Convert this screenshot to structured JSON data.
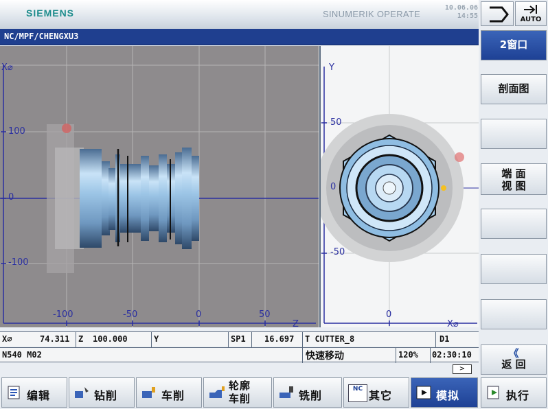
{
  "header": {
    "brand": "SIEMENS",
    "product": "SINUMERIK OPERATE",
    "date": "10.06.06",
    "time": "14:55",
    "auto_label": "AUTO",
    "colors": {
      "brand": "#1d8c8c",
      "path_bar": "#1f3f8f"
    }
  },
  "path": "NC/MPF/CHENGXU3",
  "view_side": {
    "axis_top": "X⌀",
    "axis_right": "Z",
    "y_ticks": [
      "100",
      "0",
      "-100"
    ],
    "x_ticks": [
      "-100",
      "-50",
      "0",
      "50"
    ]
  },
  "view_face": {
    "axis_top": "Y",
    "axis_right": "X⌀",
    "y_ticks": [
      "50",
      "0",
      "-50"
    ],
    "x_ticks": [
      "0"
    ]
  },
  "status": {
    "x_label": "X⌀",
    "x_value": "74.311",
    "z_label": "Z",
    "z_value": "100.000",
    "y_label": "Y",
    "sp_label": "SP1",
    "sp_value": "16.697",
    "tool": "T CUTTER_8",
    "d_value": "D1",
    "block": "N540 M02",
    "mode_text": "快速移动",
    "override": "120%",
    "run_time": "02:30:10",
    "more_arrow": ">"
  },
  "right_softkeys": {
    "two_windows": "2窗口",
    "section_view": "剖面图",
    "face_view_l1": "端 面",
    "face_view_l2": "视 图",
    "back_arrow": "《",
    "back": "返 回"
  },
  "bottom_softkeys": {
    "edit": "编辑",
    "drill": "钻削",
    "turn": "车削",
    "contour_l1": "轮廓",
    "contour_l2": "车削",
    "mill": "铣削",
    "other_nc": "NC",
    "other": "其它",
    "simulate": "模拟",
    "execute": "执行"
  }
}
